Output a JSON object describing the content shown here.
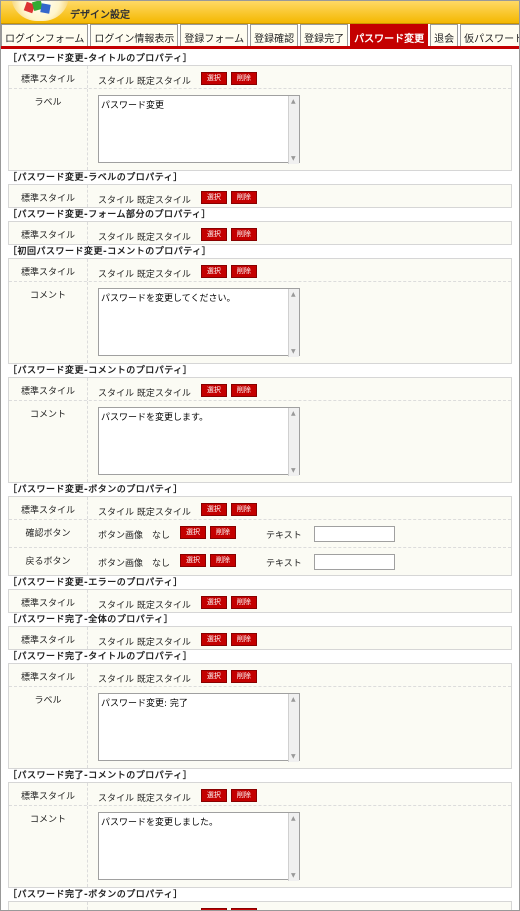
{
  "header": {
    "title": "デザイン設定"
  },
  "tabs": [
    {
      "label": "ログインフォーム"
    },
    {
      "label": "ログイン情報表示"
    },
    {
      "label": "登録フォーム"
    },
    {
      "label": "登録確認"
    },
    {
      "label": "登録完了"
    },
    {
      "label": "パスワード変更"
    },
    {
      "label": "退会"
    },
    {
      "label": "仮パスワード"
    }
  ],
  "labels": {
    "std": "標準スタイル",
    "std_value": "スタイル 既定スタイル",
    "select": "選択",
    "delete": "削除",
    "label": "ラベル",
    "comment": "コメント",
    "confirm_btn": "確認ボタン",
    "back_btn": "戻るボタン",
    "btn_image": "ボタン画像　なし",
    "text": "テキスト"
  },
  "sections": [
    {
      "title": "［パスワード変更-タイトルのプロパティ］",
      "ta_value": "パスワード変更"
    },
    {
      "title": "［パスワード変更-ラベルのプロパティ］"
    },
    {
      "title": "［パスワード変更-フォーム部分のプロパティ］"
    },
    {
      "title": "［初回パスワード変更-コメントのプロパティ］",
      "ta_value": "パスワードを変更してください。"
    },
    {
      "title": "［パスワード変更-コメントのプロパティ］",
      "ta_value": "パスワードを変更します。"
    },
    {
      "title": "［パスワード変更-ボタンのプロパティ］"
    },
    {
      "title": "［パスワード変更-エラーのプロパティ］"
    },
    {
      "title": "［パスワード完了-全体のプロパティ］"
    },
    {
      "title": "［パスワード完了-タイトルのプロパティ］",
      "ta_value": "パスワード変更: 完了"
    },
    {
      "title": "［パスワード完了-コメントのプロパティ］",
      "ta_value": "パスワードを変更しました。"
    },
    {
      "title": "［パスワード完了-ボタンのプロパティ］"
    }
  ]
}
